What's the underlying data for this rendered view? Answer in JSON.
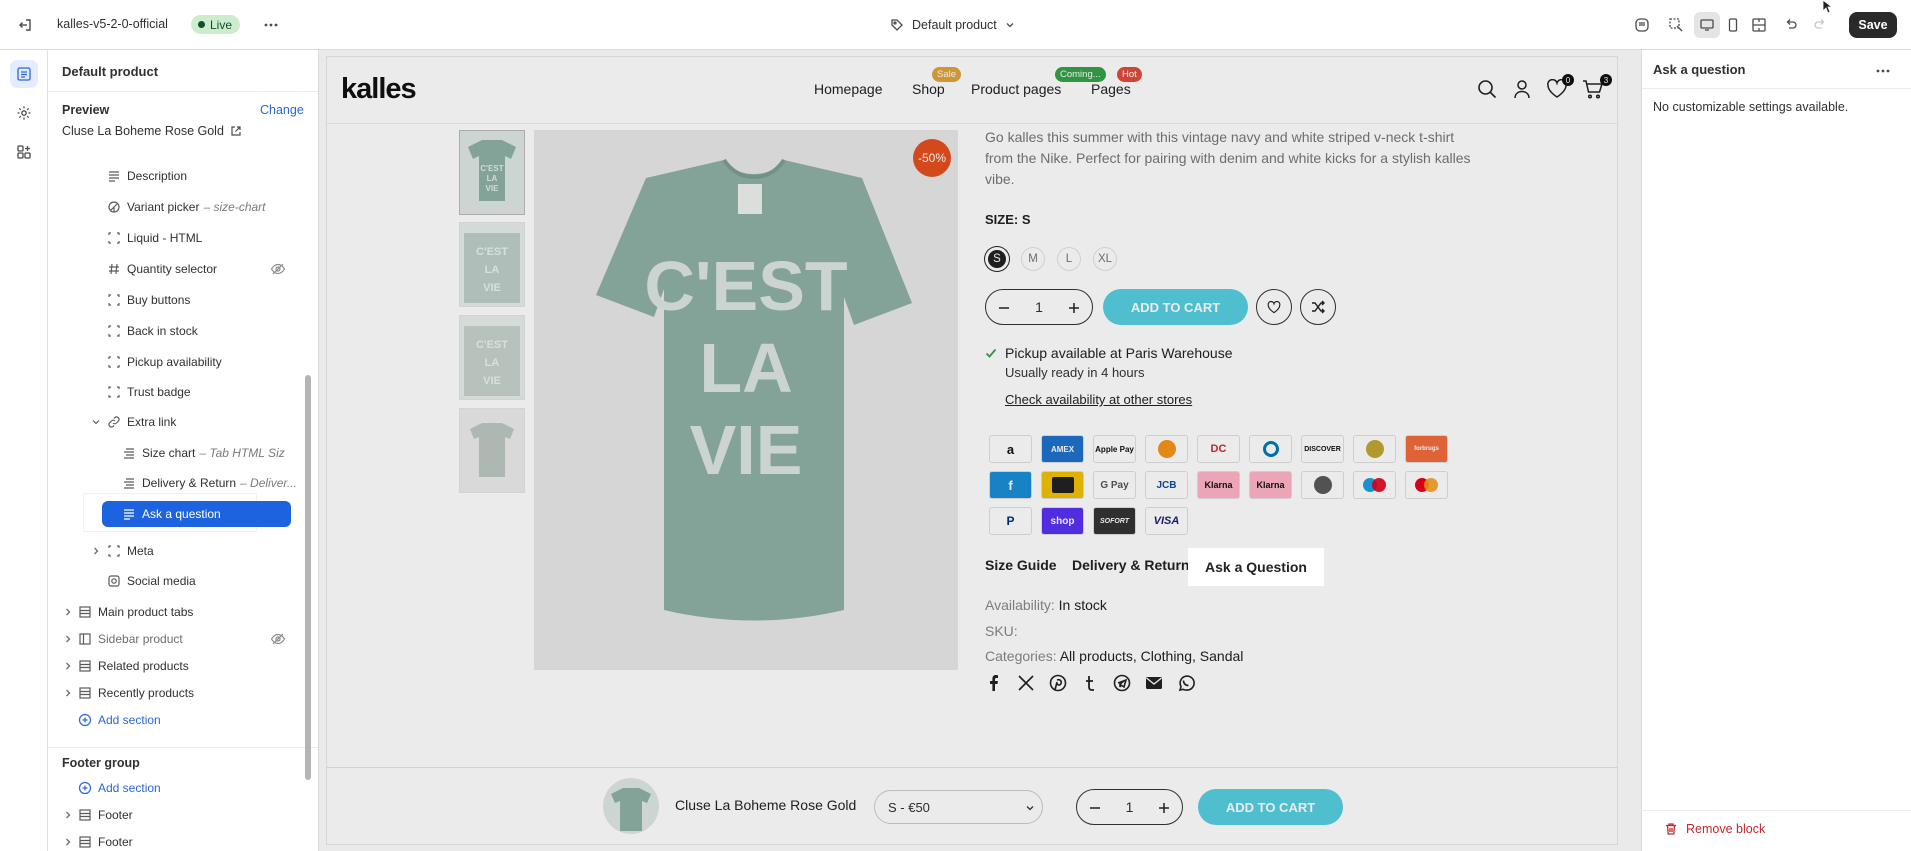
{
  "topbar": {
    "store_name": "kalles-v5-2-0-official",
    "live_badge": "Live",
    "template_name": "Default product",
    "save_label": "Save"
  },
  "left_panel": {
    "title": "Default product",
    "preview_label": "Preview",
    "change_link": "Change",
    "preview_product": "Cluse La Boheme Rose Gold",
    "blocks": [
      {
        "label": "Description",
        "sub": "",
        "icon": "text-lines-icon"
      },
      {
        "label": "Variant picker",
        "sub": "– size-chart",
        "icon": "swatch-icon"
      },
      {
        "label": "Liquid - HTML",
        "sub": "",
        "icon": "block-frame-icon"
      },
      {
        "label": "Quantity selector",
        "sub": "",
        "icon": "hash-icon",
        "hidden": true
      },
      {
        "label": "Buy buttons",
        "sub": "",
        "icon": "block-frame-icon"
      },
      {
        "label": "Back in stock",
        "sub": "",
        "icon": "block-frame-icon"
      },
      {
        "label": "Pickup availability",
        "sub": "",
        "icon": "block-frame-icon"
      },
      {
        "label": "Trust badge",
        "sub": "",
        "icon": "block-frame-icon"
      },
      {
        "label": "Extra link",
        "sub": "",
        "icon": "link-icon"
      }
    ],
    "extra_link_children": [
      {
        "label": "Size chart",
        "sub": "– Tab HTML Siz"
      },
      {
        "label": "Delivery & Return",
        "sub": "– Deliver..."
      },
      {
        "label": "Ask a question",
        "sub": ""
      }
    ],
    "after_blocks": [
      {
        "label": "Meta",
        "sub": ""
      },
      {
        "label": "Social media",
        "sub": ""
      }
    ],
    "sections": [
      {
        "label": "Main product tabs",
        "hidden": false
      },
      {
        "label": "Sidebar product",
        "hidden": true
      },
      {
        "label": "Related products",
        "hidden": false
      },
      {
        "label": "Recently products",
        "hidden": false
      }
    ],
    "add_section": "Add section",
    "footer_group_title": "Footer group",
    "footer_add_section": "Add section",
    "footer_items": [
      "Footer",
      "Footer"
    ]
  },
  "right_panel": {
    "title": "Ask a question",
    "empty_message": "No customizable settings available.",
    "remove_block": "Remove block"
  },
  "storefront": {
    "logo": "kalles",
    "nav": [
      "Homepage",
      "Shop",
      "Product pages",
      "Pages"
    ],
    "nav_badges": {
      "shop": "Sale",
      "product_pages": "Coming...",
      "pages": "Hot"
    },
    "colors": {
      "sale": "#e0a43a",
      "coming": "#36a148",
      "hot": "#e04b3a",
      "accent": "#56cfe1"
    },
    "wishlist_count": "0",
    "cart_count": "3",
    "discount_badge": "-50%",
    "tshirt_print": [
      "C'EST",
      "LA",
      "VIE"
    ],
    "description": "Go kalles this summer with this vintage navy and white striped v-neck t-shirt from the Nike. Perfect for pairing with denim and white kicks for a stylish kalles vibe.",
    "size_label": "SIZE: S",
    "sizes": [
      "S",
      "M",
      "L",
      "XL"
    ],
    "quantity": "1",
    "add_to_cart": "ADD TO CART",
    "pickup_title": "Pickup available at Paris Warehouse",
    "pickup_sub": "Usually ready in 4 hours",
    "pickup_link": "Check availability at other stores",
    "payments": [
      "amazon",
      "AMEX",
      "Apple Pay",
      "bitcoin",
      "DC",
      "diners",
      "DISCOVER",
      "dogecoin",
      "forbrugs",
      "fpx",
      "ideal",
      "G Pay",
      "JCB",
      "Klarna",
      "Klarna",
      "litecoin",
      "maestro",
      "mastercard",
      "PayPal",
      "shop",
      "SOFORT",
      "VISA"
    ],
    "tabs": [
      "Size Guide",
      "Delivery & Return",
      "Ask a Question"
    ],
    "availability_key": "Availability:",
    "availability_val": "In stock",
    "sku_key": "SKU:",
    "categories_key": "Categories:",
    "categories_val": "All products, Clothing, Sandal",
    "sticky_product": "Cluse La Boheme Rose Gold",
    "sticky_variant": "S - €50",
    "sticky_qty": "1",
    "sticky_add": "ADD TO CART"
  }
}
